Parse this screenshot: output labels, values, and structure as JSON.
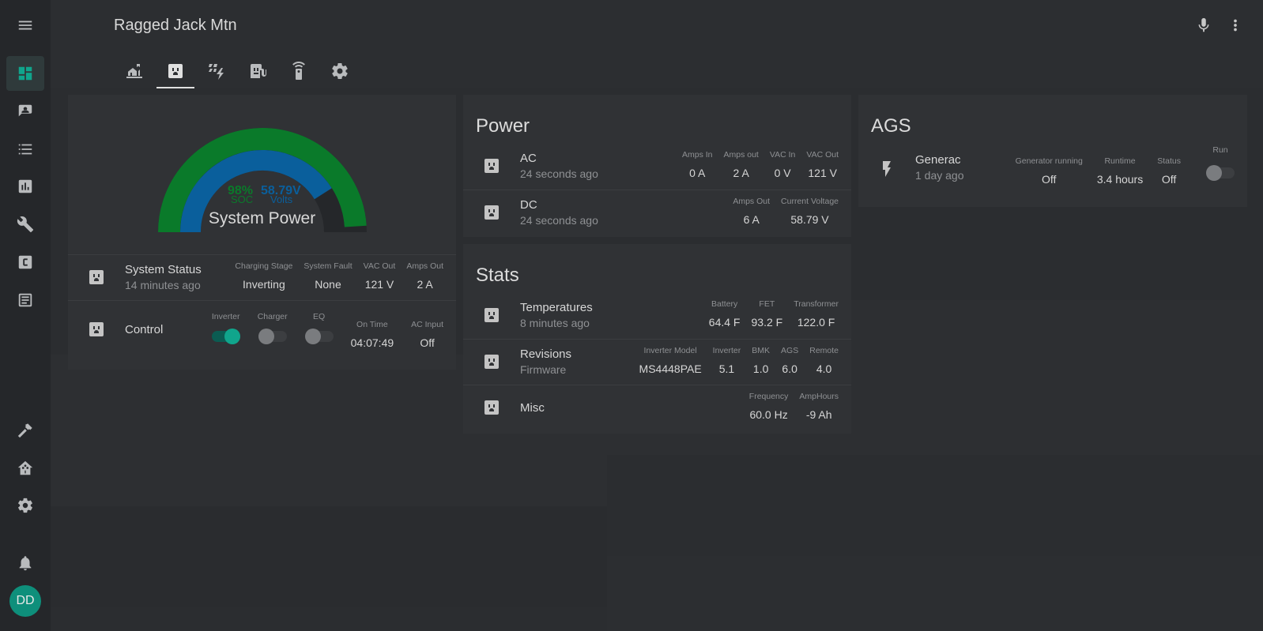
{
  "app": {
    "title": "Ragged Jack Mtn",
    "user_initials": "DD"
  },
  "icons": {
    "menu": "menu-icon",
    "mic": "microphone-icon",
    "more": "more-vertical-icon"
  },
  "sidebar": {
    "items": [
      {
        "name": "overview",
        "icon": "dashboard-icon",
        "active": true
      },
      {
        "name": "logbook",
        "icon": "account-box-icon"
      },
      {
        "name": "history",
        "icon": "format-list-icon"
      },
      {
        "name": "energy",
        "icon": "chart-box-icon"
      },
      {
        "name": "developer-tools",
        "icon": "wrench-icon"
      },
      {
        "name": "code",
        "icon": "code-box-icon"
      },
      {
        "name": "notes",
        "icon": "text-box-icon"
      }
    ],
    "bottom": [
      {
        "name": "hammer",
        "icon": "hammer-icon"
      },
      {
        "name": "home-assistant",
        "icon": "home-assistant-icon"
      },
      {
        "name": "settings",
        "icon": "cog-icon"
      },
      {
        "name": "notifications",
        "icon": "bell-icon"
      }
    ]
  },
  "tabs": [
    {
      "name": "home",
      "icon": "home-flood-icon"
    },
    {
      "name": "power",
      "icon": "power-socket-icon",
      "active": true
    },
    {
      "name": "solar",
      "icon": "solar-power-icon"
    },
    {
      "name": "charger",
      "icon": "ev-station-icon"
    },
    {
      "name": "remote",
      "icon": "remote-icon"
    },
    {
      "name": "settings",
      "icon": "cog-icon"
    }
  ],
  "gauge": {
    "soc_value": "98%",
    "soc_label": "SOC",
    "volts_value": "58.79V",
    "volts_label": "Volts",
    "caption": "System Power",
    "soc_fraction": 0.98,
    "volts_fraction": 0.82,
    "colors": {
      "soc": "#0a7a2a",
      "volts": "#0a5f9c",
      "track": "#25272a"
    }
  },
  "system_status": {
    "name": "System Status",
    "sub": "14 minutes ago",
    "attrs": [
      {
        "label": "Charging Stage",
        "value": "Inverting"
      },
      {
        "label": "System Fault",
        "value": "None"
      },
      {
        "label": "VAC Out",
        "value": "121 V"
      },
      {
        "label": "Amps Out",
        "value": "2 A"
      }
    ]
  },
  "control": {
    "name": "Control",
    "toggles": [
      {
        "label": "Inverter",
        "on": true
      },
      {
        "label": "Charger",
        "on": false
      },
      {
        "label": "EQ",
        "on": false
      }
    ],
    "attrs": [
      {
        "label": "On Time",
        "value": "04:07:49"
      },
      {
        "label": "AC Input",
        "value": "Off"
      }
    ]
  },
  "power": {
    "title": "Power",
    "rows": [
      {
        "name": "AC",
        "sub": "24 seconds ago",
        "attrs": [
          {
            "label": "Amps In",
            "value": "0 A"
          },
          {
            "label": "Amps out",
            "value": "2 A"
          },
          {
            "label": "VAC In",
            "value": "0 V"
          },
          {
            "label": "VAC Out",
            "value": "121 V"
          }
        ]
      },
      {
        "name": "DC",
        "sub": "24 seconds ago",
        "attrs": [
          {
            "label": "Amps Out",
            "value": "6 A"
          },
          {
            "label": "Current Voltage",
            "value": "58.79 V"
          }
        ]
      }
    ]
  },
  "stats": {
    "title": "Stats",
    "rows": [
      {
        "name": "Temperatures",
        "sub": "8 minutes ago",
        "attrs": [
          {
            "label": "Battery",
            "value": "64.4 F"
          },
          {
            "label": "FET",
            "value": "93.2 F"
          },
          {
            "label": "Transformer",
            "value": "122.0 F"
          }
        ]
      },
      {
        "name": "Revisions",
        "sub": "Firmware",
        "attrs": [
          {
            "label": "Inverter Model",
            "value": "MS4448PAE"
          },
          {
            "label": "Inverter",
            "value": "5.1"
          },
          {
            "label": "BMK",
            "value": "1.0"
          },
          {
            "label": "AGS",
            "value": "6.0"
          },
          {
            "label": "Remote",
            "value": "4.0"
          }
        ]
      },
      {
        "name": "Misc",
        "sub": "",
        "attrs": [
          {
            "label": "Frequency",
            "value": "60.0 Hz"
          },
          {
            "label": "AmpHours",
            "value": "-9 Ah"
          }
        ]
      }
    ]
  },
  "ags": {
    "title": "AGS",
    "row": {
      "name": "Generac",
      "sub": "1 day ago",
      "attrs": [
        {
          "label": "Generator running",
          "value": "Off"
        },
        {
          "label": "Runtime",
          "value": "3.4 hours"
        },
        {
          "label": "Status",
          "value": "Off"
        }
      ],
      "toggle": {
        "label": "Run",
        "on": false
      }
    }
  }
}
